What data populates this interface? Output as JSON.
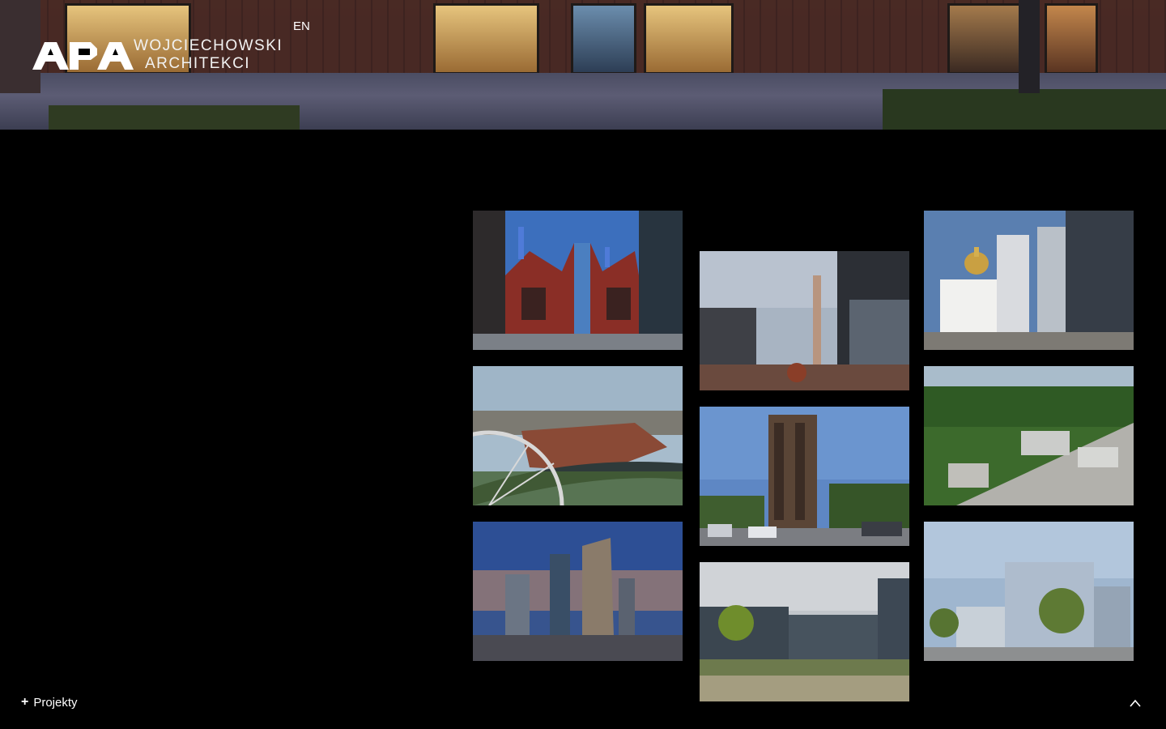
{
  "brand": {
    "name_line1": "WOJCIECHOWSKI",
    "name_line2": "ARCHITEKCI",
    "mark_icon": "apa-logo-icon"
  },
  "header": {
    "language_label": "EN"
  },
  "gallery": {
    "tiles": [
      {
        "image": "red-brick-factory-hall"
      },
      {
        "image": "chimney-courtyard-offices"
      },
      {
        "image": "orthodox-church-and-office-towers"
      },
      {
        "image": "riverside-brick-housing-with-ferris-wheel"
      },
      {
        "image": "timber-clad-residential-tower"
      },
      {
        "image": "aerial-city-district-green-hills"
      },
      {
        "image": "glass-skyscrapers-at-sunset"
      },
      {
        "image": "glass-office-campus-with-garden"
      },
      {
        "image": "modern-office-complex-with-trees"
      }
    ]
  },
  "footer": {
    "projects_label": "Projekty",
    "projects_icon": "plus-icon",
    "scroll_icon": "chevron-up-icon"
  },
  "colors": {
    "background": "#000000",
    "text": "#ffffff"
  }
}
